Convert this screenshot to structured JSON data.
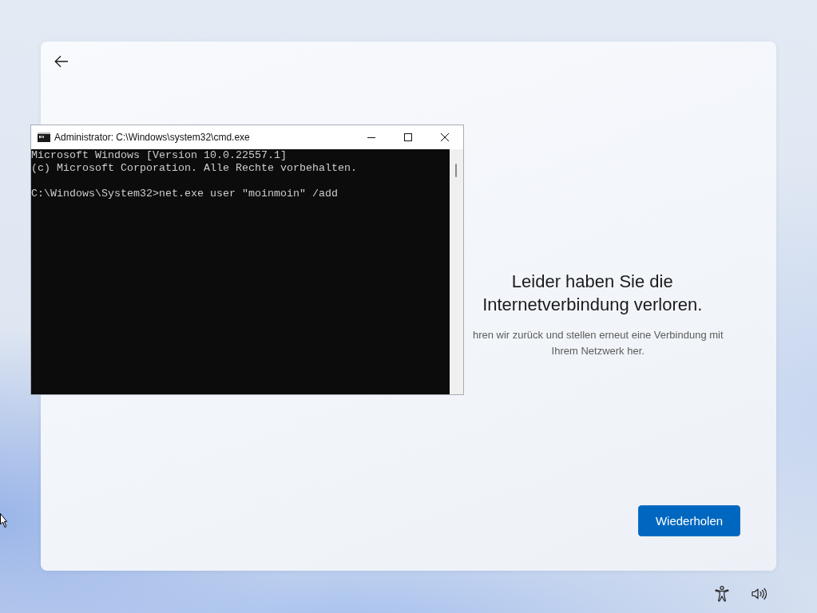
{
  "console_window": {
    "title": "Administrator: C:\\Windows\\system32\\cmd.exe",
    "output_lines": [
      "Microsoft Windows [Version 10.0.22557.1]",
      "(c) Microsoft Corporation. Alle Rechte vorbehalten."
    ],
    "command_line": "C:\\Windows\\System32>net.exe user \"moinmoin\" /add"
  },
  "page": {
    "title": "Leider haben Sie die\nInternetverbindung verloren.",
    "description": "hren wir zurück und stellen erneut eine Verbindung mit\nIhrem Netzwerk her.",
    "retry_button": "Wiederholen"
  }
}
